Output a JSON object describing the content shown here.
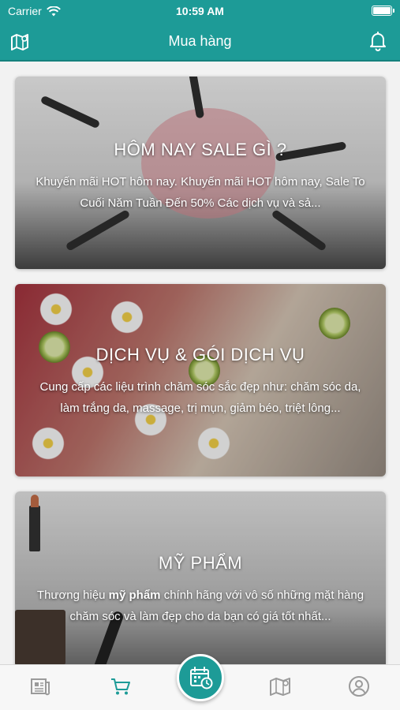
{
  "status_bar": {
    "carrier": "Carrier",
    "time": "10:59 AM"
  },
  "nav": {
    "title": "Mua hàng",
    "left_icon": "map-icon",
    "right_icon": "bell-icon"
  },
  "cards": [
    {
      "title": "HÔM NAY SALE GÌ ?",
      "description": "Khuyến mãi HOT hôm nay. Khuyến mãi HOT hôm nay, Sale To Cuối Năm Tuần Đến 50% Các dịch vụ và sả..."
    },
    {
      "title": "DỊCH VỤ & GÓI DỊCH VỤ",
      "description": "Cung cấp các liệu trình chăm sóc sắc đẹp như: chăm sóc da, làm trắng da, massage, trị mụn, giảm béo, triệt lông..."
    },
    {
      "title": "MỸ PHẨM",
      "description_before": "Thương hiệu ",
      "description_bold": "mỹ phẩm",
      "description_after": " chính hãng với vô số những mặt hàng chăm sóc và làm đẹp cho da bạn có giá tốt nhất..."
    }
  ],
  "tab_bar": {
    "tabs": [
      "news-icon",
      "cart-icon",
      "booking-calendar-icon",
      "map-icon",
      "profile-icon"
    ],
    "active": "cart-icon"
  },
  "colors": {
    "primary": "#1d9b97",
    "tab_inactive": "#9a9a9a"
  }
}
